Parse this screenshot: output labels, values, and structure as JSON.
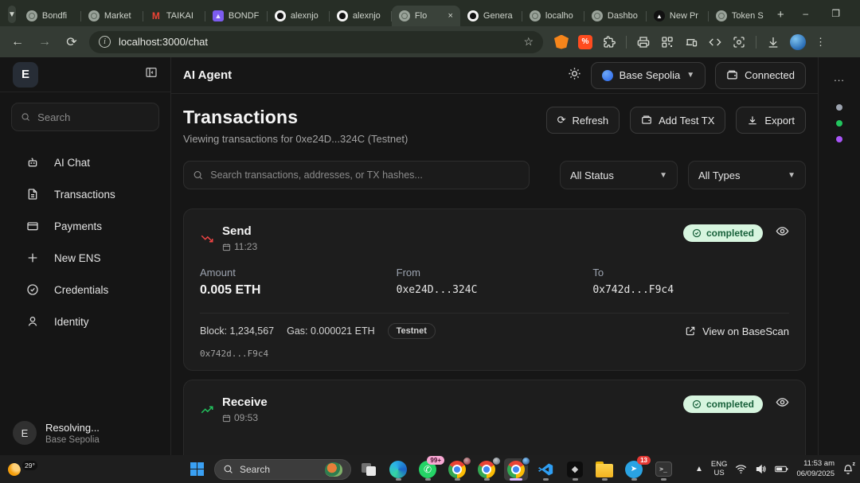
{
  "browser": {
    "tab_search_chevron": "v",
    "tabs": [
      {
        "label": "Bondfi",
        "icon": "globe"
      },
      {
        "label": "Market",
        "icon": "globe"
      },
      {
        "label": "TAIKAI",
        "icon": "gmail"
      },
      {
        "label": "BONDF",
        "icon": "delta"
      },
      {
        "label": "alexnjo",
        "icon": "github"
      },
      {
        "label": "alexnjo",
        "icon": "github"
      },
      {
        "label": "Flo",
        "icon": "globe",
        "active": true,
        "close": "×"
      },
      {
        "label": "Genera",
        "icon": "github"
      },
      {
        "label": "localho",
        "icon": "globe"
      },
      {
        "label": "Dashbo",
        "icon": "globe"
      },
      {
        "label": "New Pr",
        "icon": "vercel"
      },
      {
        "label": "Token S",
        "icon": "globe"
      }
    ],
    "new_tab": "+",
    "window_controls": {
      "minimize": "–",
      "maximize": "❐",
      "close": "✕"
    },
    "url": "localhost:3000/chat"
  },
  "sidebar": {
    "logo": "E",
    "search_placeholder": "Search",
    "items": [
      {
        "label": "AI Chat"
      },
      {
        "label": "Transactions"
      },
      {
        "label": "Payments"
      },
      {
        "label": "New ENS"
      },
      {
        "label": "Credentials"
      },
      {
        "label": "Identity"
      }
    ],
    "footer": {
      "avatar": "E",
      "title": "Resolving...",
      "subtitle": "Base Sepolia"
    }
  },
  "header": {
    "title": "AI Agent",
    "network": "Base Sepolia",
    "connection": "Connected"
  },
  "page": {
    "title": "Transactions",
    "subtitle": "Viewing transactions for 0xe24D...324C (Testnet)",
    "refresh_label": "Refresh",
    "add_test_label": "Add Test TX",
    "export_label": "Export",
    "search_placeholder": "Search transactions, addresses, or TX hashes...",
    "status_filter": "All Status",
    "type_filter": "All Types"
  },
  "cards": [
    {
      "type": "Send",
      "time": "11:23",
      "status": "completed",
      "amount_label": "Amount",
      "amount": "0.005 ETH",
      "from_label": "From",
      "from": "0xe24D...324C",
      "to_label": "To",
      "to": "0x742d...F9c4",
      "block": "Block: 1,234,567",
      "gas": "Gas: 0.000021 ETH",
      "network_badge": "Testnet",
      "explorer_link": "View on BaseScan",
      "hash": "0x742d...F9c4"
    },
    {
      "type": "Receive",
      "time": "09:53",
      "status": "completed"
    }
  ],
  "side_panel": {
    "menu": "...",
    "dot_colors": [
      "#9ca3af",
      "#22c55e",
      "#a855f7"
    ]
  },
  "taskbar": {
    "weather_temp": "29°",
    "search_label": "Search",
    "whatsapp_badge": "99+",
    "telegram_badge": "13",
    "tray": {
      "lang_line1": "ENG",
      "lang_line2": "US",
      "time": "11:53 am",
      "date": "06/09/2025"
    }
  },
  "colors": {
    "badge_bg": "#d7f5df",
    "badge_text": "#17603a",
    "send_red": "#ef4444",
    "receive_green": "#22c55e",
    "network_dot_blue": "#2563eb"
  }
}
